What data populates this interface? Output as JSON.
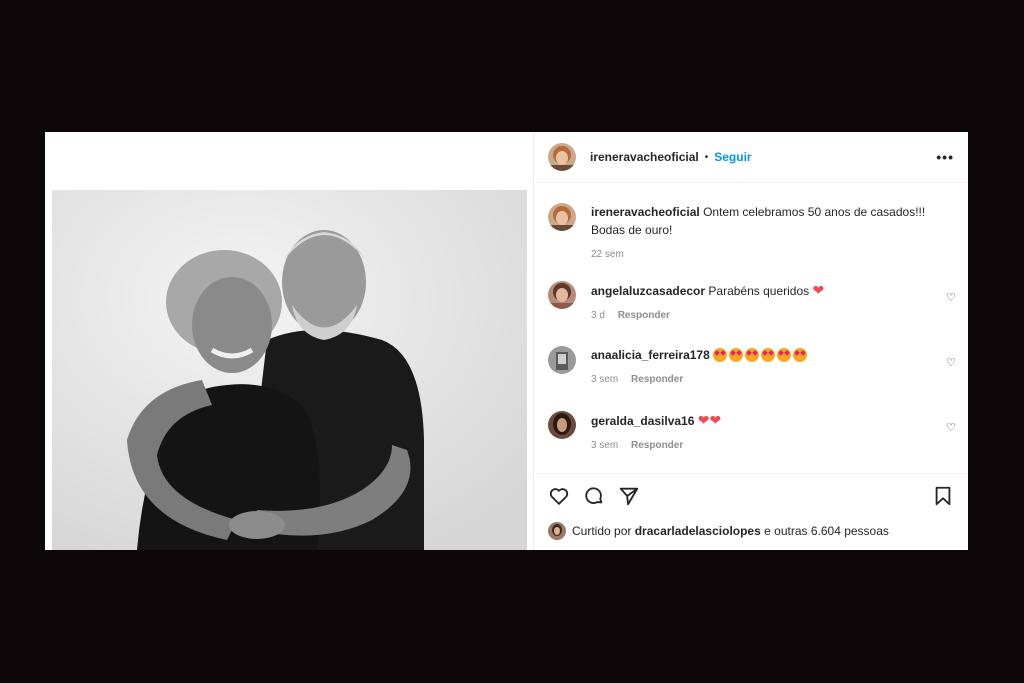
{
  "header": {
    "username": "ireneravacheoficial",
    "separator": "•",
    "follow_label": "Seguir",
    "more_icon": "•••"
  },
  "caption": {
    "username": "ireneravacheoficial",
    "text": "Ontem celebramos 50 anos de casados!!! Bodas de ouro!",
    "time": "22 sem"
  },
  "comments": [
    {
      "username": "angelaluzcasadecor",
      "text": "Parabéns queridos",
      "emoji": "❤",
      "time": "3 d",
      "reply_label": "Responder"
    },
    {
      "username": "anaalicia_ferreira178",
      "text": "",
      "emoji_count": 6,
      "time": "3 sem",
      "reply_label": "Responder"
    },
    {
      "username": "geralda_dasilva16",
      "text": "",
      "emoji": "❤❤",
      "time": "3 sem",
      "reply_label": "Responder"
    }
  ],
  "likes": {
    "prefix": "Curtido por",
    "user": "dracarladelasciolopes",
    "suffix": "e outras 6.604 pessoas"
  },
  "icons": {
    "heart_outline": "♡",
    "like": "heart-icon",
    "comment": "comment-icon",
    "share": "share-icon",
    "save": "bookmark-icon"
  },
  "colors": {
    "accent": "#0095f6",
    "text": "#262626",
    "meta": "#8e8e8e",
    "red_heart": "#ed4956"
  }
}
